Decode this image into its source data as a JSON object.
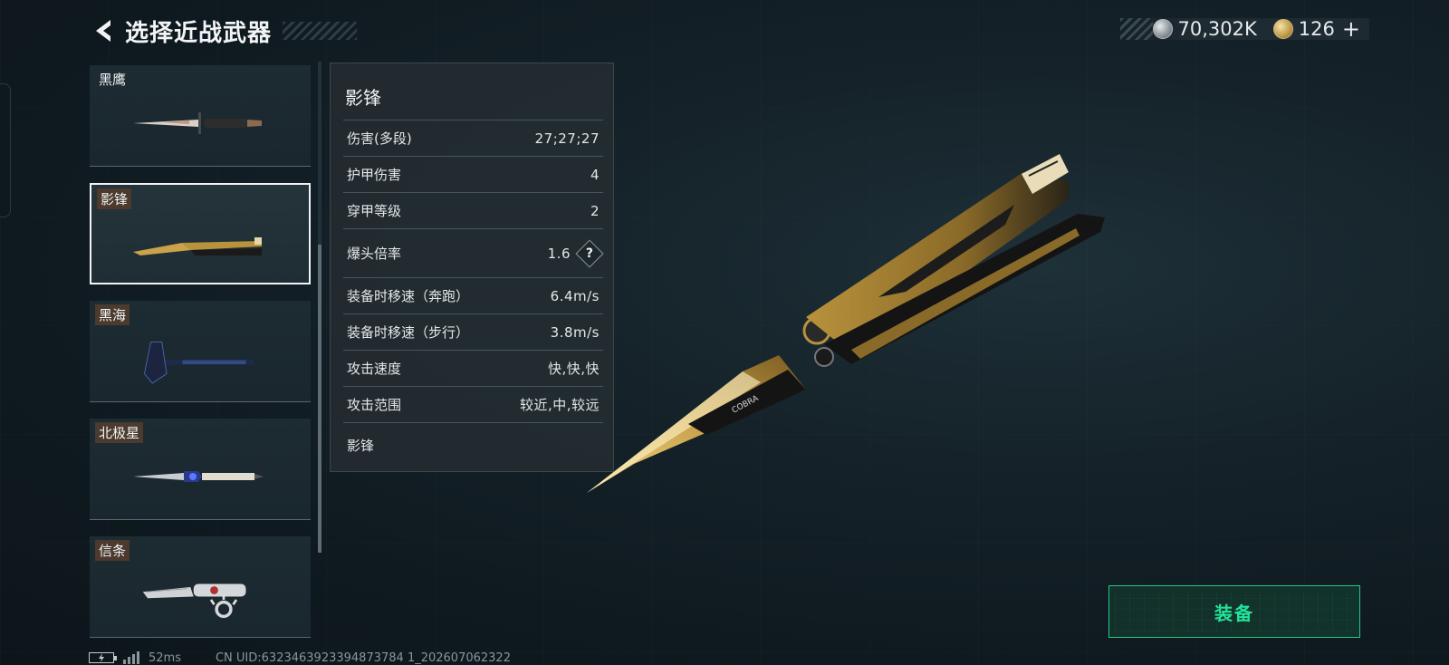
{
  "header": {
    "title": "选择近战武器"
  },
  "currency": {
    "silver": "70,302K",
    "gold": "126",
    "plus": "+"
  },
  "weapons": [
    {
      "name": "黑鹰"
    },
    {
      "name": "影锋"
    },
    {
      "name": "黑海"
    },
    {
      "name": "北极星"
    },
    {
      "name": "信条"
    }
  ],
  "selected_weapon": "影锋",
  "stats": {
    "title": "影锋",
    "rows": [
      {
        "label": "伤害(多段)",
        "value": "27;27;27"
      },
      {
        "label": "护甲伤害",
        "value": "4"
      },
      {
        "label": "穿甲等级",
        "value": "2"
      },
      {
        "label": "爆头倍率",
        "value": "1.6",
        "help": "?"
      },
      {
        "label": "装备时移速（奔跑）",
        "value": "6.4m/s"
      },
      {
        "label": "装备时移速（步行）",
        "value": "3.8m/s"
      },
      {
        "label": "攻击速度",
        "value": "快,快,快"
      },
      {
        "label": "攻击范围",
        "value": "较近,中,较远"
      }
    ],
    "description": "影锋"
  },
  "equip": {
    "label": "装备"
  },
  "footer": {
    "ping": "52ms",
    "uid": "CN UID:6323463923394873784 1_202607062322"
  },
  "colors": {
    "accent": "#22e39b",
    "gold": "#c9a24a",
    "panel": "#232c31"
  }
}
